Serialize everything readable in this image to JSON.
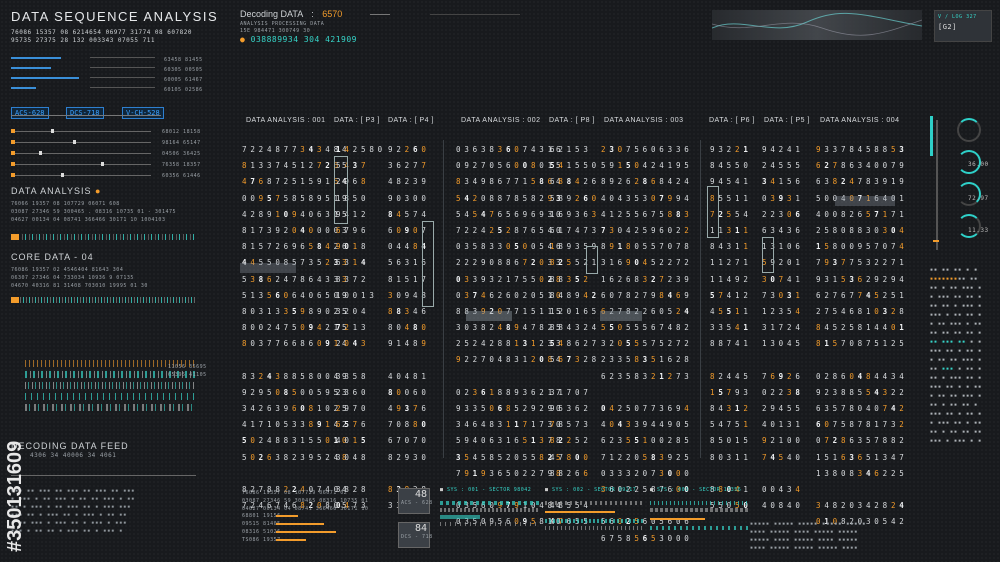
{
  "header": {
    "title": "DATA SEQUENCE ANALYSIS",
    "row1": "76086 15357 08 6214654 06977 31774 08 607820",
    "row2": "95735 27375 28 132 003343 07055 711",
    "decoding_label": "Decoding DATA",
    "decoding_sep": ":",
    "decoding_value": "6570",
    "processing": "ANALYSIS PROCESSING DATA",
    "processing_sub": "15E 984471 300749 30",
    "id_line": "038889934 304 421909",
    "top_right_code": "V / LOG 327",
    "top_right_sub": "[G2]"
  },
  "left_panel": {
    "bar_codes": [
      "63458 81455",
      "60305 00505",
      "60005 61467",
      "60105 02586"
    ],
    "tags": [
      "ACS-628",
      "DCS-718",
      "V-CH-528"
    ],
    "slider_codes": [
      "68012 18158",
      "98164 65147",
      "04506 36425",
      "76358 18357",
      "60356 61446"
    ],
    "data_analysis": "DATA ANALYSIS",
    "data_analysis_rows": [
      "76066 19357 08 107729 06071 608",
      "03087 27346 59 300465 . 08316 10735 01 - 301475",
      "04627 00134 04 08741 366466 30171 10 1004103"
    ],
    "core_data": "CORE DATA - 04",
    "core_rows": [
      "76086 19357 02 4546404 81643 304",
      "06307 27346 04 733034 10936 9 07135",
      "04670 40316 81 31408 703010 19995 01 30"
    ],
    "feed_codes": [
      "11056 35695",
      "65395 41105"
    ],
    "feed_label": "DECODING DATA FEED",
    "feed_row": "4306 34 40006 34 4061"
  },
  "analysis_headers": [
    {
      "label": "DATA ANALYSIS : 001",
      "boxed": true
    },
    {
      "label": "DATA : [ P3 ]",
      "boxed": false
    },
    {
      "label": "DATA : [ P4 ]",
      "boxed": false
    },
    {
      "label": "DATA ANALYSIS : 002",
      "boxed": true
    },
    {
      "label": "DATA : [ P8 ]",
      "boxed": false
    },
    {
      "label": "DATA ANALYSIS : 003",
      "boxed": true
    },
    {
      "label": "DATA : [ P6 ]",
      "boxed": false
    },
    {
      "label": "DATA : [ P5 ]",
      "boxed": false
    },
    {
      "label": "DATA ANALYSIS : 004",
      "boxed": true
    }
  ],
  "columns": {
    "c1": [
      "7224877343484",
      "8133745127265",
      "4768725159164",
      "0095758589519",
      "4289109406315",
      "8173920400003",
      "8157269658426",
      "4455085735233",
      "5386247864333",
      "5135606406509",
      "8031335989025",
      "8002475094215",
      "8037766860914",
      "",
      "8324388580049",
      "9295085005953",
      "3426396081025",
      "4171053389142",
      "5024883155010",
      "5026382395248",
      "",
      "8278822407404",
      "7246746820805"
    ],
    "c2": [
      "142580",
      "5437",
      "2968",
      "1850",
      "9412",
      "6796",
      "9018",
      "6314",
      "8372",
      "10013",
      "3204",
      "7213",
      "2043",
      "",
      "3358",
      "2360",
      "2970",
      "6576",
      "4015",
      "3048",
      "",
      "3828",
      "0473"
    ],
    "c3": [
      "92260",
      "36277",
      "48239",
      "90300",
      "84574",
      "60907",
      "04484",
      "56316",
      "81517",
      "30948",
      "88346",
      "80480",
      "91489",
      "",
      "40481",
      "80060",
      "49376",
      "70880",
      "67070",
      "82930",
      "",
      "83828",
      "33349"
    ],
    "c4": [
      "0363836074316",
      "0927056008015",
      "8349867715864",
      "5420887858293",
      "5454765696930",
      "7224252876540",
      "0358330500546",
      "2229088672033",
      "0339321755028",
      "0374626020510",
      "8839207715115",
      "3038248947825",
      "2524288131233",
      "9227048312084",
      "",
      "0236188936217",
      "9335068529290",
      "3464831171730",
      "5940631651378",
      "3545852055825",
      "7919365022798",
      "",
      "0356097910484",
      "0350956095810"
    ],
    "c5": [
      "62153",
      "541550",
      "688426",
      "589260",
      "169363",
      "617473",
      "189359",
      "825521",
      "88352",
      "848942",
      "120165",
      "884324",
      "548627",
      "567328",
      "",
      "31707",
      "95362",
      "78573",
      "82252",
      "47800",
      "88266",
      "",
      "48554",
      "47655"
    ],
    "c6": [
      "23075606336",
      "59150424195",
      "89262868424",
      "40435307994",
      "41255675883",
      "73042596022",
      "89180557078",
      "31690452272",
      "16268327239",
      "60782798469",
      "62782260524",
      "55055567482",
      "32055575272",
      "23358351628",
      "62358321273",
      "",
      "04250773694",
      "40433944905",
      "62355100285",
      "71220583925",
      "03332073000",
      "36022587600",
      "",
      "56025605606",
      "67585653000"
    ],
    "c7": [
      "93221",
      "84550",
      "94541",
      "85511",
      "72554",
      "11311",
      "84311",
      "11271",
      "11492",
      "57412",
      "45511",
      "33541",
      "88741",
      "",
      "82445",
      "15793",
      "84312",
      "54751",
      "85015",
      "80311",
      "",
      "88041",
      "55050"
    ],
    "c8": [
      "94241",
      "24555",
      "34156",
      "03931",
      "22306",
      "63436",
      "13106",
      "59201",
      "30741",
      "73031",
      "12354",
      "31724",
      "13045",
      "",
      "76926",
      "02238",
      "29455",
      "40131",
      "92100",
      "74540",
      "",
      "00434",
      "40840"
    ],
    "c9": [
      "93378458853",
      "62786340079",
      "63824783919",
      "50040716401",
      "40082657171",
      "25808830304",
      "15800957074",
      "79377532271",
      "93153629294",
      "62767745251",
      "27546810328",
      "84525814401",
      "81570875125",
      "",
      "02860484434",
      "92388554322",
      "63578040742",
      "60758781732",
      "07286357882",
      "15163651347",
      "13808346225",
      "",
      "34820342824",
      "01082030542"
    ]
  },
  "right_rings": [
    "36.00",
    "72.97",
    "11.33"
  ],
  "bottom": {
    "left_rows": [
      "76086 19357 08 107729 06071 02",
      "03087 27346 59 300465 08316 10735 01",
      "04627 00134 04 08741 366466 30171 10"
    ],
    "bar_rows": [
      "68801 19156",
      "09515 81405",
      "08316 51026",
      "TS086 19357"
    ],
    "counter_a": "48",
    "counter_a_sub": "ACS - 628",
    "counter_b": "84",
    "counter_b_sub": "DCS - 718",
    "sys": [
      "SYS : 001 - SECTOR 98042",
      "SYS : 002 - SECTOR 89217",
      "SYS : 003 - SECTOR 17356"
    ]
  },
  "watermarks": {
    "id": "#350131609"
  },
  "colors": {
    "background": "#181a1d",
    "orange": "#f39c2b",
    "teal": "#36d4c8",
    "blue": "#3aa0ff",
    "header_box": "#8a9299"
  }
}
